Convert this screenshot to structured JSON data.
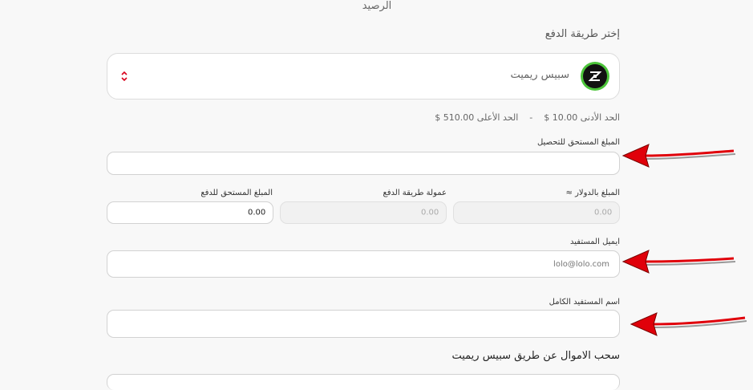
{
  "header": {
    "balance_label": "الرصيد"
  },
  "payment": {
    "section_label": "إختر طريقة الدفع",
    "selected_method": "سبيس ريميت",
    "limits": {
      "min_label": "الحد الأدنى",
      "min_value": "10.00 $",
      "separator": "-",
      "max_label": "الحد الأعلى",
      "max_value": "510.00 $"
    }
  },
  "form": {
    "collect_amount_label": "المبلغ المستحق للتحصيل",
    "collect_amount_value": "",
    "usd_amount_label": "المبلغ بالدولار ≈",
    "usd_amount_value": "0.00",
    "fee_label": "عمولة طريقة الدفع",
    "fee_value": "0.00",
    "due_label": "المبلغ المستحق للدفع",
    "due_value": "0.00",
    "email_label": "ايميل المستفيد",
    "email_placeholder": "lolo@lolo.com",
    "fullname_label": "اسم المستفيد الكامل",
    "fullname_value": ""
  },
  "footer": {
    "withdraw_title": "سحب الاموال عن طريق سبيس ريميت"
  },
  "colors": {
    "arrow": "#e0000a",
    "logo_ring": "#4cc43a",
    "accent_red": "#d9001b"
  }
}
